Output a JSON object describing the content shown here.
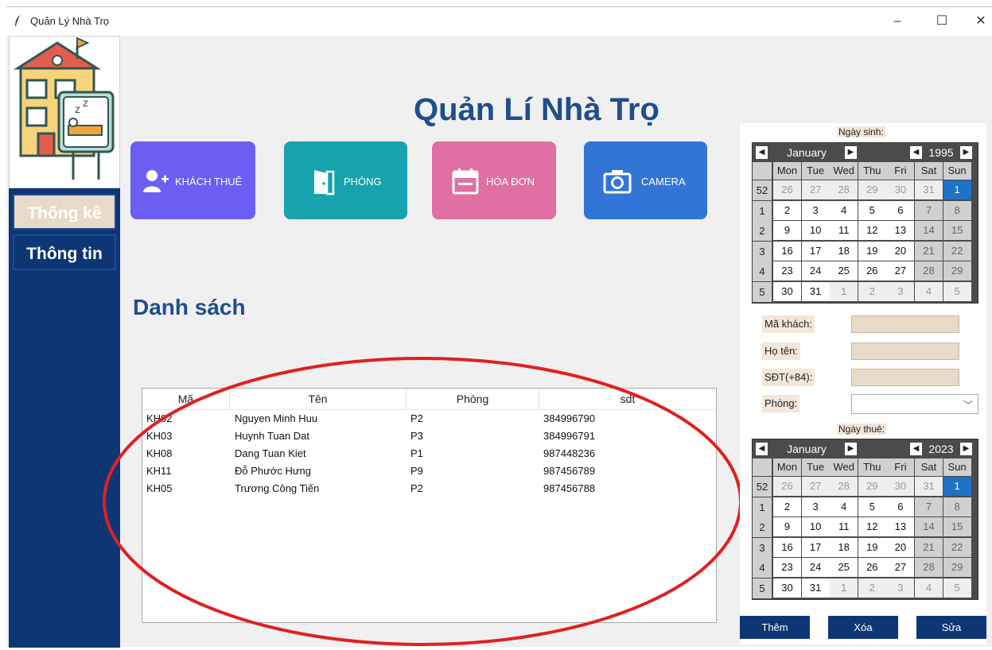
{
  "window": {
    "title": "Quản Lý Nhà Trọ",
    "min": "–",
    "max": "☐",
    "close": "✕"
  },
  "sidebar": {
    "stats_label": "Thống kê",
    "info_label": "Thông tin"
  },
  "header": {
    "title": "Quản Lí Nhà Trọ"
  },
  "nav": [
    {
      "label": "KHÁCH THUÊ",
      "color": "#6a5ff2",
      "icon": "add-person-icon"
    },
    {
      "label": "PHÒNG",
      "color": "#16a3ad",
      "icon": "door-icon"
    },
    {
      "label": "HÓA ĐƠN",
      "color": "#e06fa3",
      "icon": "calendar-icon"
    },
    {
      "label": "CAMERA",
      "color": "#3375d6",
      "icon": "camera-icon"
    }
  ],
  "list": {
    "title": "Danh sách",
    "columns": [
      "Mã",
      "Tên",
      "Phòng",
      "sdt"
    ],
    "rows": [
      [
        "KH02",
        "Nguyen Minh Huu",
        "P2",
        "384996790"
      ],
      [
        "KH03",
        "Huynh Tuan Dat",
        "P3",
        "384996791"
      ],
      [
        "KH08",
        "Dang Tuan Kiet",
        "P1",
        "987448236"
      ],
      [
        "KH11",
        "Đỗ Phước Hưng",
        "P9",
        "987456789"
      ],
      [
        "KH05",
        "Trương Công Tiến",
        "P2",
        "987456788"
      ]
    ]
  },
  "form": {
    "birth_label": "Ngày sinh:",
    "rent_label": "Ngày thuê:",
    "fields": {
      "id": "Mã khách:",
      "name": "Họ tên:",
      "phone": "SĐT(+84):",
      "room": "Phòng:"
    },
    "room_value": ""
  },
  "calendars": {
    "birth": {
      "month": "January",
      "year": "1995",
      "dows": [
        "Mon",
        "Tue",
        "Wed",
        "Thu",
        "Fri",
        "Sat",
        "Sun"
      ],
      "weeks": [
        "52",
        "1",
        "2",
        "3",
        "4",
        "5"
      ],
      "days": [
        [
          "26",
          "27",
          "28",
          "29",
          "30",
          "31",
          "1"
        ],
        [
          "2",
          "3",
          "4",
          "5",
          "6",
          "7",
          "8"
        ],
        [
          "9",
          "10",
          "11",
          "12",
          "13",
          "14",
          "15"
        ],
        [
          "16",
          "17",
          "18",
          "19",
          "20",
          "21",
          "22"
        ],
        [
          "23",
          "24",
          "25",
          "26",
          "27",
          "28",
          "29"
        ],
        [
          "30",
          "31",
          "1",
          "2",
          "3",
          "4",
          "5"
        ]
      ],
      "selected": "1"
    },
    "rent": {
      "month": "January",
      "year": "2023",
      "dows": [
        "Mon",
        "Tue",
        "Wed",
        "Thu",
        "Fri",
        "Sat",
        "Sun"
      ],
      "weeks": [
        "52",
        "1",
        "2",
        "3",
        "4",
        "5"
      ],
      "days": [
        [
          "26",
          "27",
          "28",
          "29",
          "30",
          "31",
          "1"
        ],
        [
          "2",
          "3",
          "4",
          "5",
          "6",
          "7",
          "8"
        ],
        [
          "9",
          "10",
          "11",
          "12",
          "13",
          "14",
          "15"
        ],
        [
          "16",
          "17",
          "18",
          "19",
          "20",
          "21",
          "22"
        ],
        [
          "23",
          "24",
          "25",
          "26",
          "27",
          "28",
          "29"
        ],
        [
          "30",
          "31",
          "1",
          "2",
          "3",
          "4",
          "5"
        ]
      ],
      "selected": "1"
    }
  },
  "actions": {
    "add": "Thêm",
    "delete": "Xóa",
    "edit": "Sửa"
  },
  "annotation": {
    "color": "#e02020"
  }
}
